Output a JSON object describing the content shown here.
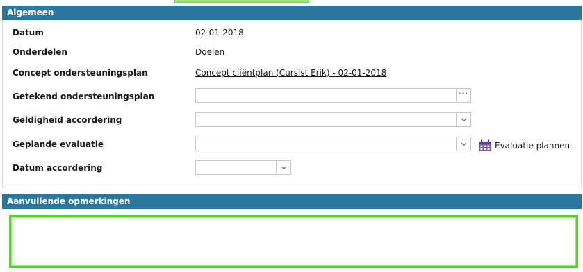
{
  "general": {
    "header": "Algemeen",
    "rows": {
      "datum": {
        "label": "Datum",
        "value": "02-01-2018"
      },
      "onderdelen": {
        "label": "Onderdelen",
        "value": "Doelen"
      },
      "concept": {
        "label": "Concept ondersteuningsplan",
        "link": "Concept cliëntplan (Cursist Erik) - 02-01-2018"
      },
      "getekend": {
        "label": "Getekend ondersteuningsplan",
        "value": ""
      },
      "geldigheid": {
        "label": "Geldigheid accordering",
        "value": ""
      },
      "evaluatie": {
        "label": "Geplande evaluatie",
        "value": ""
      },
      "datum_accordering": {
        "label": "Datum accordering",
        "value": ""
      }
    },
    "evaluate_button": {
      "label": "Evaluatie plannen",
      "icon": "calendar-icon"
    }
  },
  "remarks": {
    "header": "Aanvullende opmerkingen",
    "value": ""
  },
  "colors": {
    "header_bg": "#2a78a0",
    "highlight": "#50d228"
  }
}
